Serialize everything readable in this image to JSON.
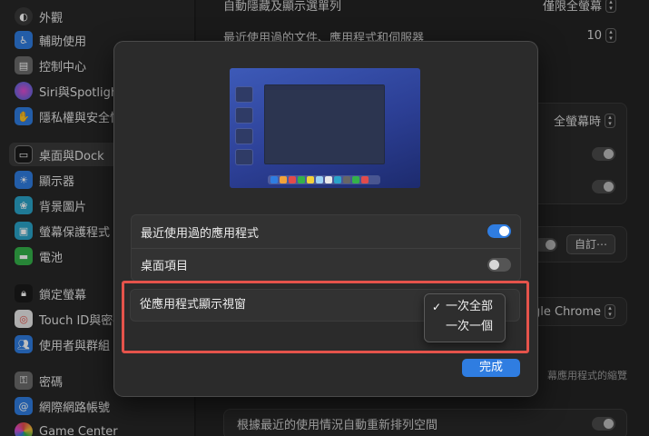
{
  "sidebar": {
    "items": [
      {
        "label": "外觀",
        "icon": "appearance-icon",
        "color": "#3a3a3a"
      },
      {
        "label": "輔助使用",
        "icon": "accessibility-icon",
        "color": "#2f7de1"
      },
      {
        "label": "控制中心",
        "icon": "control-center-icon",
        "color": "#6b6b6b"
      },
      {
        "label": "Siri與Spotlight",
        "icon": "siri-icon",
        "color": "#8a4fd8"
      },
      {
        "label": "隱私權與安全性",
        "icon": "privacy-hand-icon",
        "color": "#2f7de1"
      },
      {
        "label": "桌面與Dock",
        "icon": "desktop-dock-icon",
        "color": "#1a1a1a"
      },
      {
        "label": "顯示器",
        "icon": "display-sun-icon",
        "color": "#2f7de1"
      },
      {
        "label": "背景圖片",
        "icon": "wallpaper-icon",
        "color": "#2aa3c9"
      },
      {
        "label": "螢幕保護程式",
        "icon": "screensaver-icon",
        "color": "#2aa3c9"
      },
      {
        "label": "電池",
        "icon": "battery-icon",
        "color": "#34b24a"
      },
      {
        "label": "鎖定螢幕",
        "icon": "lock-icon",
        "color": "#1a1a1a"
      },
      {
        "label": "Touch ID與密碼",
        "icon": "fingerprint-icon",
        "color": "#e0e0e0"
      },
      {
        "label": "使用者與群組",
        "icon": "users-icon",
        "color": "#2f7de1"
      },
      {
        "label": "密碼",
        "icon": "key-icon",
        "color": "#6b6b6b"
      },
      {
        "label": "網際網路帳號",
        "icon": "at-sign-icon",
        "color": "#2f7de1"
      },
      {
        "label": "Game Center",
        "icon": "game-center-icon",
        "color": "#e0e0e0"
      }
    ]
  },
  "main": {
    "row_top": "自動隱藏及顯示選單列",
    "row_top_value": "僅限全螢幕",
    "recent_docs": "最近使用過的文件、應用程式和伺服器",
    "recent_docs_value": "10",
    "fullscreen_value": "全螢幕時",
    "custom_button": "自訂⋯",
    "browser_value": "gle Chrome",
    "note_text": "幕應用程式的縮覽",
    "rearrange_spaces": "根據最近的使用情況自動重新排列空間"
  },
  "sheet": {
    "options": [
      {
        "label": "最近使用過的應用程式",
        "toggle": "on"
      },
      {
        "label": "桌面項目",
        "toggle": "off"
      }
    ],
    "group_windows_label": "從應用程式顯示視窗",
    "menu": [
      {
        "label": "一次全部",
        "checked": true
      },
      {
        "label": "一次一個",
        "checked": false
      }
    ],
    "done_label": "完成"
  },
  "colors": {
    "accent": "#2f7de1",
    "highlight_outline": "#e5534b"
  }
}
